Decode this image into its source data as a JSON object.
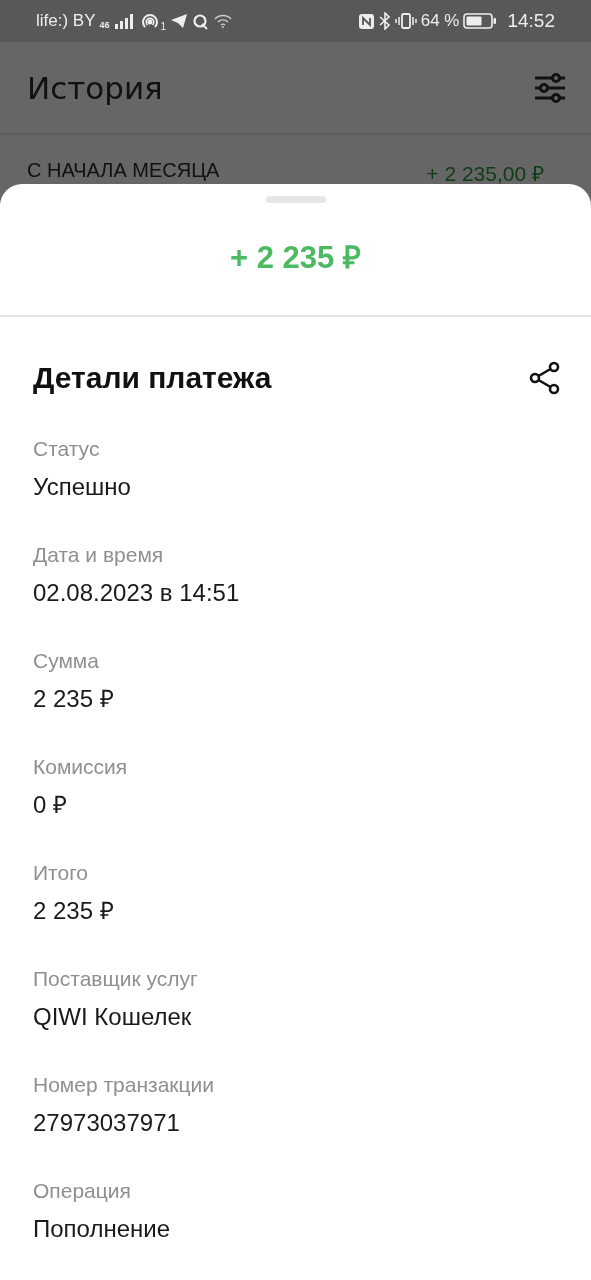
{
  "status_bar": {
    "carrier": "life:) BY",
    "network": "46",
    "hotspot_count": "1",
    "battery": "64 %",
    "time": "14:52"
  },
  "header": {
    "title": "История"
  },
  "summary": {
    "label": "С НАЧАЛА МЕСЯЦА",
    "amount": "+ 2 235,00 ₽"
  },
  "sheet": {
    "amount": "+ 2 235 ₽",
    "title": "Детали платежа",
    "fields": [
      {
        "label": "Статус",
        "value": "Успешно"
      },
      {
        "label": "Дата и время",
        "value": "02.08.2023 в 14:51"
      },
      {
        "label": "Сумма",
        "value": "2 235 ₽"
      },
      {
        "label": "Комиссия",
        "value": "0 ₽"
      },
      {
        "label": "Итого",
        "value": "2 235 ₽"
      },
      {
        "label": "Поставщик услуг",
        "value": "QIWI Кошелек"
      },
      {
        "label": "Номер транзакции",
        "value": "27973037971"
      },
      {
        "label": "Операция",
        "value": "Пополнение"
      }
    ]
  }
}
